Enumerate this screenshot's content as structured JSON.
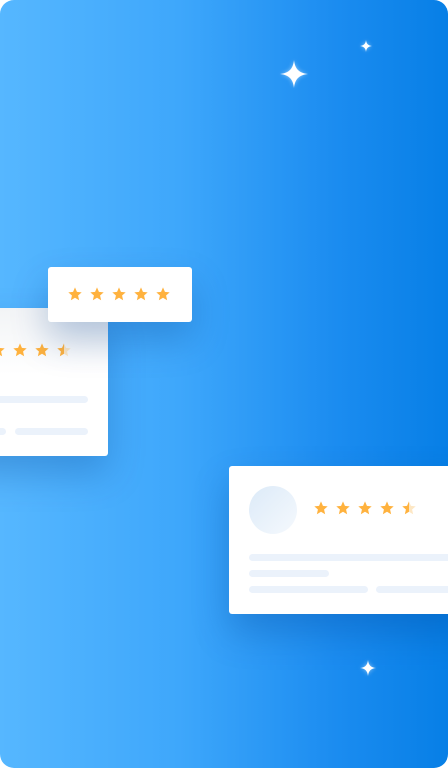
{
  "colors": {
    "gradient_start": "#56b7ff",
    "gradient_end": "#077fe6",
    "star": "#ffb23e",
    "placeholder_line": "#ebf2fb",
    "card": "#ffffff"
  },
  "top_review": {
    "rating": 5,
    "max_rating": 5
  },
  "left_review": {
    "rating": 4.5,
    "max_rating": 5
  },
  "bottom_review": {
    "rating": 4.5,
    "max_rating": 5
  },
  "decorations": {
    "sparkle_icon": "four-point-star"
  }
}
